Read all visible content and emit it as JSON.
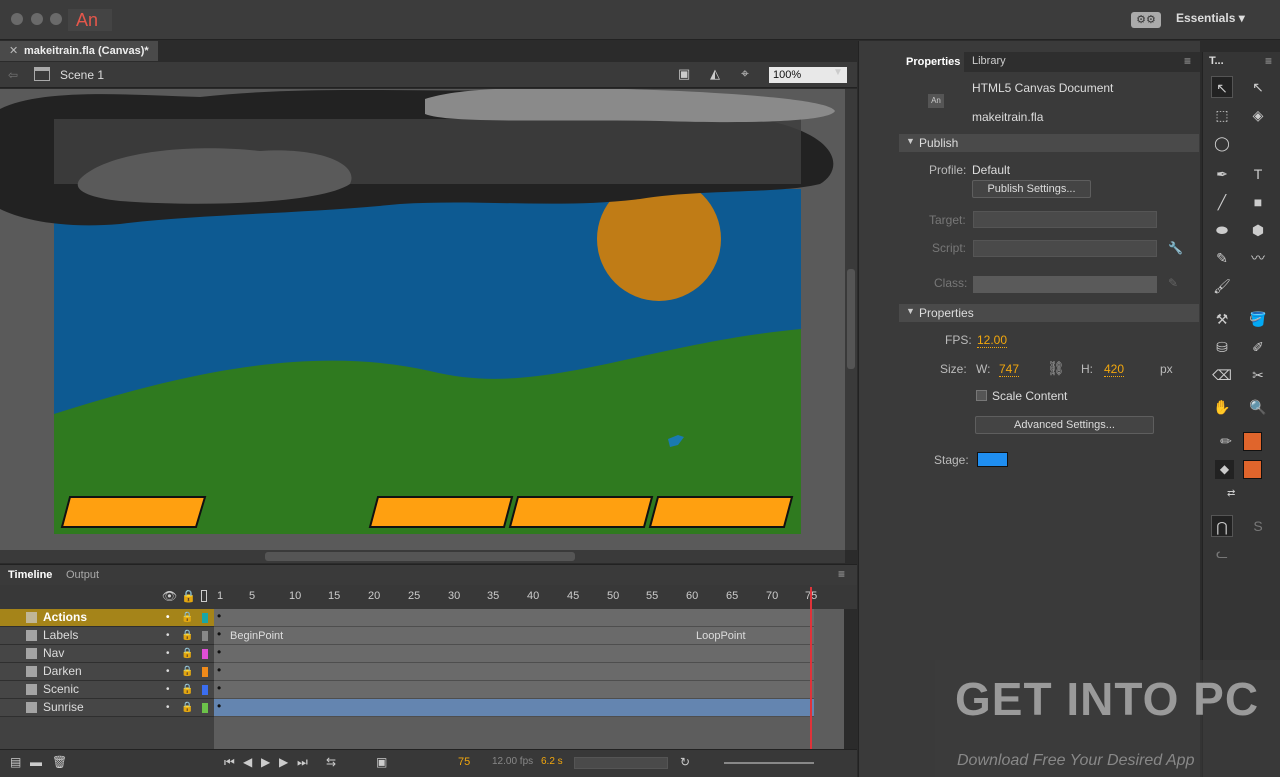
{
  "app": {
    "logo": "An",
    "workspace": "Essentials"
  },
  "document": {
    "tab_title": "makeitrain.fla (Canvas)*",
    "scene": "Scene 1",
    "zoom": "100%"
  },
  "timeline": {
    "tabs": [
      "Timeline",
      "Output"
    ],
    "ruler": [
      "1",
      "5",
      "10",
      "15",
      "20",
      "25",
      "30",
      "35",
      "40",
      "45",
      "50",
      "55",
      "60",
      "65",
      "70",
      "75"
    ],
    "layers": [
      {
        "name": "Actions",
        "selected": true,
        "color": "#19a6a6"
      },
      {
        "name": "Labels",
        "selected": false,
        "color": "#888888"
      },
      {
        "name": "Nav",
        "selected": false,
        "color": "#e04ed6"
      },
      {
        "name": "Darken",
        "selected": false,
        "color": "#f08a1a"
      },
      {
        "name": "Scenic",
        "selected": false,
        "color": "#3b6ef0"
      },
      {
        "name": "Sunrise",
        "selected": false,
        "color": "#6cc24a"
      }
    ],
    "labels": {
      "begin": "BeginPoint",
      "loop": "LoopPoint"
    },
    "current_frame": "75",
    "fps": "12.00 fps",
    "time": "6.2 s"
  },
  "properties": {
    "tabs": [
      "Properties",
      "Library"
    ],
    "doc_type": "HTML5 Canvas Document",
    "file": "makeitrain.fla",
    "publish_section": "Publish",
    "profile_label": "Profile:",
    "profile_value": "Default",
    "publish_settings": "Publish Settings...",
    "target_label": "Target:",
    "script_label": "Script:",
    "class_label": "Class:",
    "properties_section": "Properties",
    "fps_label": "FPS:",
    "fps_value": "12.00",
    "size_label": "Size:",
    "w_label": "W:",
    "w_value": "747",
    "h_label": "H:",
    "h_value": "420",
    "px": "px",
    "scale_content": "Scale Content",
    "advanced_settings": "Advanced Settings...",
    "stage_label": "Stage:",
    "stage_color": "#1f8ef0"
  },
  "tools_title": "T...",
  "watermark": {
    "main": "GET INTO PC",
    "tagline": "Download Free Your Desired App"
  }
}
